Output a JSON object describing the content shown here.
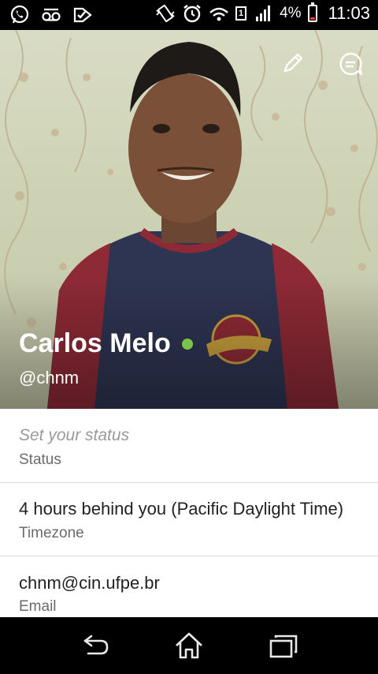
{
  "status_bar": {
    "left_icons": [
      "whatsapp-icon",
      "voicemail-icon",
      "notification-check-icon"
    ],
    "right_icons": [
      "vibrate-icon",
      "alarm-icon",
      "wifi-icon",
      "sim-1-icon",
      "signal-icon",
      "battery-icon"
    ],
    "sim_label": "1",
    "battery_percent": "4%",
    "battery_color": "#e53935",
    "time": "11:03"
  },
  "profile": {
    "name": "Carlos Melo",
    "username": "@chnm",
    "presence_color": "#7cc24b",
    "actions": [
      "edit-pencil-icon",
      "chat-bubble-icon"
    ]
  },
  "fields": {
    "status": {
      "placeholder": "Set your status",
      "label": "Status"
    },
    "timezone": {
      "value": "4 hours behind you (Pacific Daylight Time)",
      "label": "Timezone"
    },
    "email": {
      "value": "chnm@cin.ufpe.br",
      "label": "Email"
    }
  },
  "nav_bar": {
    "buttons": [
      "back-icon",
      "home-icon",
      "recent-apps-icon"
    ]
  }
}
